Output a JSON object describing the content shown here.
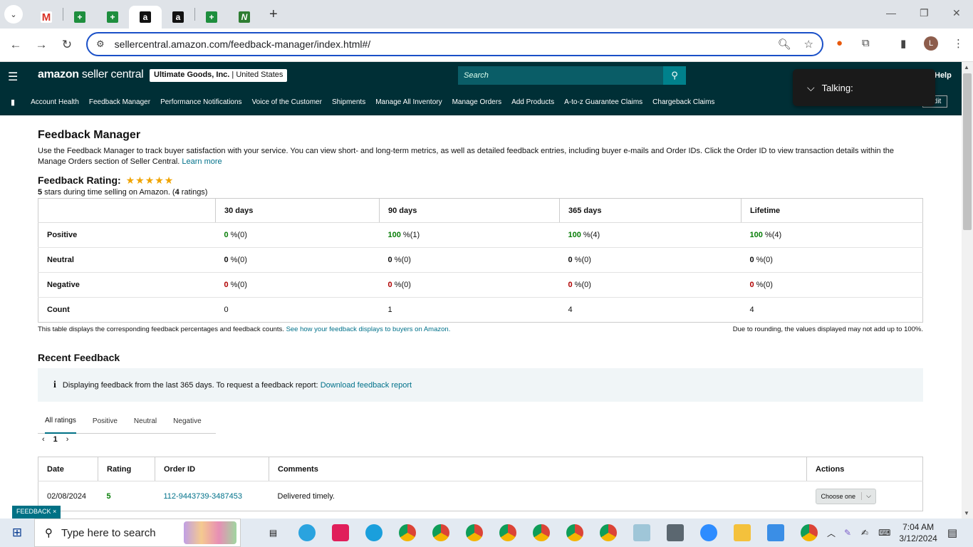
{
  "browser": {
    "url": "sellercentral.amazon.com/feedback-manager/index.html#/",
    "profile_initial": "L",
    "tabs": [
      "gmail",
      "sheets",
      "sheets",
      "amazon",
      "amazon",
      "sheets",
      "pen"
    ]
  },
  "header": {
    "logo_bold": "amazon",
    "logo_light": " seller central",
    "store_name": "Ultimate Goods, Inc.",
    "store_region": " | United States",
    "search_placeholder": "Search",
    "help": "Help",
    "edit": "Edit",
    "nav": [
      "Account Health",
      "Feedback Manager",
      "Performance Notifications",
      "Voice of the Customer",
      "Shipments",
      "Manage All Inventory",
      "Manage Orders",
      "Add Products",
      "A-to-z Guarantee Claims",
      "Chargeback Claims"
    ]
  },
  "overlay": {
    "talking": "Talking:"
  },
  "page": {
    "title": "Feedback Manager",
    "description": "Use the Feedback Manager to track buyer satisfaction with your service. You can view short- and long-term metrics, as well as detailed feedback entries, including buyer e-mails and Order IDs. Click the Order ID to view transaction details within the Manage Orders section of Seller Central.",
    "learn_more": "Learn more",
    "rating_label": "Feedback Rating:",
    "rating_stars": 5,
    "rating_sub_stars": "5",
    "rating_sub_mid": " stars during time selling on Amazon. (",
    "rating_sub_count": "4",
    "rating_sub_end": " ratings)"
  },
  "metrics": {
    "columns": [
      "30 days",
      "90 days",
      "365 days",
      "Lifetime"
    ],
    "rows": [
      {
        "label": "Positive",
        "cells": [
          {
            "v": "0",
            "c": "(0)"
          },
          {
            "v": "100",
            "c": "(1)"
          },
          {
            "v": "100",
            "c": "(4)"
          },
          {
            "v": "100",
            "c": "(4)"
          }
        ]
      },
      {
        "label": "Neutral",
        "cells": [
          {
            "v": "0",
            "c": "(0)"
          },
          {
            "v": "0",
            "c": "(0)"
          },
          {
            "v": "0",
            "c": "(0)"
          },
          {
            "v": "0",
            "c": "(0)"
          }
        ]
      },
      {
        "label": "Negative",
        "cells": [
          {
            "v": "0",
            "c": "(0)"
          },
          {
            "v": "0",
            "c": "(0)"
          },
          {
            "v": "0",
            "c": "(0)"
          },
          {
            "v": "0",
            "c": "(0)"
          }
        ]
      }
    ],
    "count_label": "Count",
    "counts": [
      "0",
      "1",
      "4",
      "4"
    ],
    "note_left": "This table displays the corresponding feedback percentages and feedback counts.",
    "note_link": "See how your feedback displays to buyers on Amazon.",
    "note_right": "Due to rounding, the values displayed may not add up to 100%."
  },
  "recent": {
    "title": "Recent Feedback",
    "info": "Displaying feedback from the last 365 days. To request a feedback report:",
    "info_link": "Download feedback report",
    "tabs": [
      "All ratings",
      "Positive",
      "Neutral",
      "Negative"
    ],
    "page": "1",
    "columns": [
      "Date",
      "Rating",
      "Order ID",
      "Comments",
      "Actions"
    ],
    "rows": [
      {
        "date": "02/08/2024",
        "rating": "5",
        "order_id": "112-9443739-3487453",
        "comment": "Delivered timely.",
        "action": "Choose one"
      }
    ]
  },
  "feedback_tab": "FEEDBACK ×",
  "taskbar": {
    "search_placeholder": "Type here to search",
    "time": "7:04 AM",
    "date": "3/12/2024"
  },
  "colors": {
    "header": "#002f36",
    "link": "#00718a",
    "positive": "#067d06",
    "negative": "#b00000"
  }
}
